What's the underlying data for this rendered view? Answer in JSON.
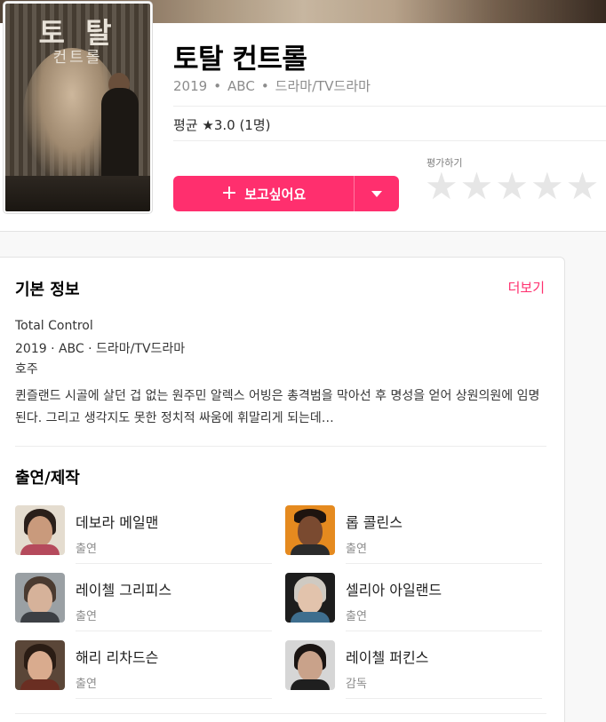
{
  "header": {
    "poster_title": "토 탈",
    "poster_subtitle": "컨트롤",
    "title": "토탈 컨트롤",
    "meta": {
      "year": "2019",
      "network": "ABC",
      "genre": "드라마/TV드라마"
    },
    "rating_text": "평균 ★3.0 (1명)",
    "want_button_label": "보고싶어요",
    "rate_label": "평가하기",
    "star_count": 5
  },
  "basic_info": {
    "title": "기본 정보",
    "more_label": "더보기",
    "original_title": "Total Control",
    "summary_line": "2019 · ABC · 드라마/TV드라마",
    "country": "호주",
    "description": "퀸즐랜드 시골에 살던 겁 없는 원주민 알렉스 어빙은 총격범을 막아선 후 명성을 얻어 상원의원에 임명된다. 그리고 생각지도 못한 정치적 싸움에 휘말리게 되는데…"
  },
  "cast_section": {
    "title": "출연/제작",
    "members": [
      {
        "name": "데보라 메일맨",
        "role": "출연",
        "icon": "person-photo"
      },
      {
        "name": "롭 콜린스",
        "role": "출연",
        "icon": "person-photo"
      },
      {
        "name": "레이첼 그리피스",
        "role": "출연",
        "icon": "person-photo"
      },
      {
        "name": "셀리아 아일랜드",
        "role": "출연",
        "icon": "person-photo"
      },
      {
        "name": "해리 리차드슨",
        "role": "출연",
        "icon": "person-photo"
      },
      {
        "name": "레이첼 퍼킨스",
        "role": "감독",
        "icon": "person-photo"
      }
    ]
  },
  "colors": {
    "accent": "#ff2f6e",
    "star_empty": "#e6e6e6"
  }
}
